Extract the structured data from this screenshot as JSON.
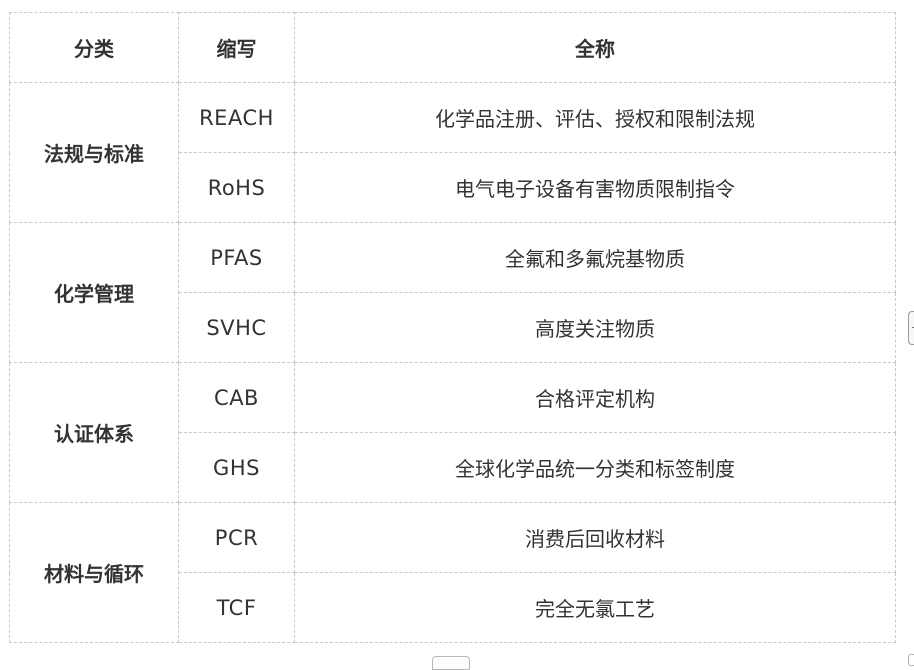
{
  "table": {
    "headers": [
      "分类",
      "缩写",
      "全称"
    ],
    "groups": [
      {
        "category": "法规与标准",
        "rows": [
          {
            "abbr": "REACH",
            "full": "化学品注册、评估、授权和限制法规"
          },
          {
            "abbr": "RoHS",
            "full": "电气电子设备有害物质限制指令"
          }
        ]
      },
      {
        "category": "化学管理",
        "rows": [
          {
            "abbr": "PFAS",
            "full": "全氟和多氟烷基物质"
          },
          {
            "abbr": "SVHC",
            "full": "高度关注物质"
          }
        ]
      },
      {
        "category": "认证体系",
        "rows": [
          {
            "abbr": "CAB",
            "full": "合格评定机构"
          },
          {
            "abbr": "GHS",
            "full": "全球化学品统一分类和标签制度"
          }
        ]
      },
      {
        "category": "材料与循环",
        "rows": [
          {
            "abbr": "PCR",
            "full": "消费后回收材料"
          },
          {
            "abbr": "TCF",
            "full": "完全无氯工艺"
          }
        ]
      }
    ]
  }
}
